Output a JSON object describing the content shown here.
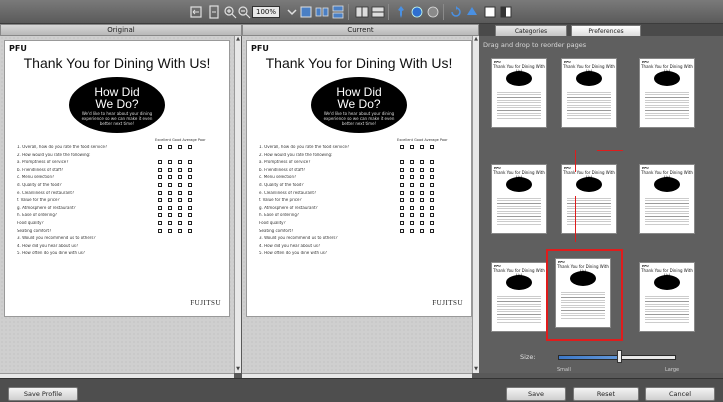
{
  "toolbar": {
    "zoom_value": "100%",
    "buttons": [
      "fit-width-icon",
      "fit-page-icon",
      "zoom-in-icon",
      "zoom-out-icon",
      "single-page-icon",
      "two-page-icon",
      "continuous-icon",
      "split-h-icon",
      "split-v-icon",
      "pin-icon",
      "blue-circle-icon",
      "gray-circle-icon",
      "rotate-icon",
      "settings-icon",
      "color-square-icon",
      "split-square-icon"
    ]
  },
  "panels": {
    "original_label": "Original",
    "current_label": "Current"
  },
  "document": {
    "logo": "PFU",
    "title": "Thank You for Dining With Us!",
    "oval_title_line1": "How Did",
    "oval_title_line2": "We Do?",
    "oval_subtitle": "We'd like to hear about your dining experience so we can make it even better next time!",
    "scale_head": "Excellent Good Average Poor",
    "questions": [
      "1. Overall, how do you rate the food service?",
      "2. How would you rate the following:",
      "   a. Promptness of service?",
      "   b. Friendliness of staff?",
      "   c. Menu selection?",
      "   d. Quality of the food?",
      "   e. Cleanliness of restaurant?",
      "   f. Value for the price?",
      "   g. Atmosphere of restaurant?",
      "   h. Ease of ordering?",
      "      Food quality?",
      "      Seating comfort?",
      "3. Would you recommend us to others?",
      "4. How did you hear about us?",
      "5. How often do you dine with us?"
    ],
    "brand": "FUJITSU"
  },
  "right_panel": {
    "tabs": [
      "Categories",
      "Preferences"
    ],
    "hint": "Drag and drop to reorder pages",
    "thumb_title": "Thank You for Dining With Us!",
    "slider_label": "Size:",
    "slider_min": "Small",
    "slider_max": "Large",
    "slider_level": 0.5
  },
  "bottom": {
    "left_button": "Save Profile",
    "buttons": [
      "Save",
      "Reset",
      "Cancel"
    ]
  },
  "colors": {
    "selection": "#e01c1c",
    "slider_fill": "#3c78c8"
  }
}
